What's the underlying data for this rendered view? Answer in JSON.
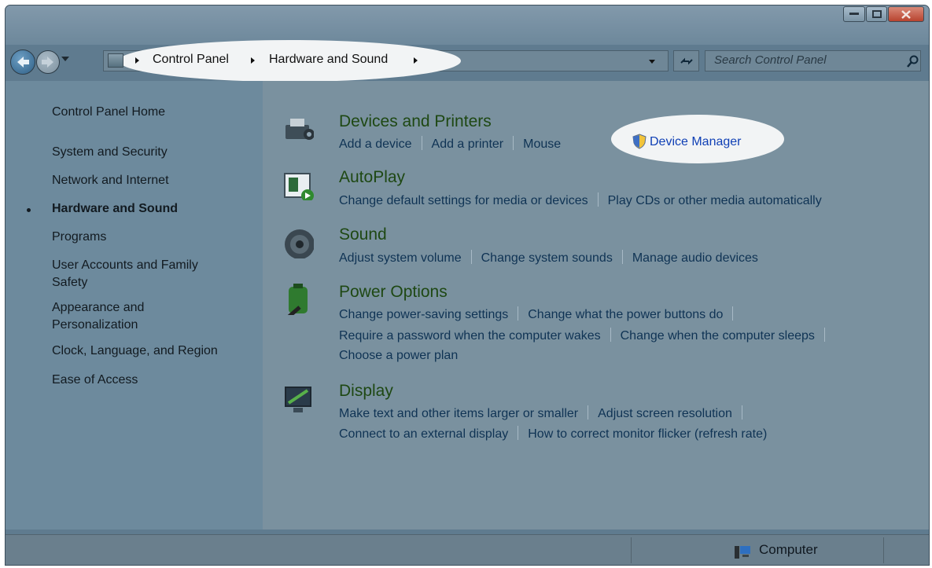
{
  "window": {
    "buttons": [
      "minimize",
      "maximize",
      "close"
    ]
  },
  "nav": {
    "back_icon": "back-arrow-icon",
    "forward_icon": "forward-arrow-icon"
  },
  "address": {
    "breadcrumbs": [
      "Control Panel",
      "Hardware and Sound"
    ],
    "separator_icon": "chevron-right-icon"
  },
  "search": {
    "placeholder": "Search Control Panel",
    "icon": "search-icon"
  },
  "sidebar": {
    "items": [
      {
        "label": "Control Panel Home"
      },
      {
        "label": "System and Security"
      },
      {
        "label": "Network and Internet"
      },
      {
        "label": "Hardware and Sound",
        "active": true
      },
      {
        "label": "Programs"
      },
      {
        "label": "User Accounts and Family Safety"
      },
      {
        "label": "Appearance and Personalization"
      },
      {
        "label": "Clock, Language, and Region"
      },
      {
        "label": "Ease of Access"
      }
    ]
  },
  "categories": [
    {
      "title": "Devices and Printers",
      "icon": "printer-camera-icon",
      "links": [
        "Add a device",
        "Add a printer",
        "Mouse",
        "Device Manager"
      ]
    },
    {
      "title": "AutoPlay",
      "icon": "autoplay-icon",
      "links": [
        "Change default settings for media or devices",
        "Play CDs or other media automatically"
      ]
    },
    {
      "title": "Sound",
      "icon": "speaker-icon",
      "links": [
        "Adjust system volume",
        "Change system sounds",
        "Manage audio devices"
      ]
    },
    {
      "title": "Power Options",
      "icon": "battery-plug-icon",
      "links": [
        "Change power-saving settings",
        "Change what the power buttons do",
        "Require a password when the computer wakes",
        "Change when the computer sleeps",
        "Choose a power plan"
      ]
    },
    {
      "title": "Display",
      "icon": "monitor-icon",
      "links": [
        "Make text and other items larger or smaller",
        "Adjust screen resolution",
        "Connect to an external display",
        "How to correct monitor flicker (refresh rate)"
      ]
    }
  ],
  "highlight": {
    "device_manager_icon": "uac-shield-icon"
  },
  "status": {
    "location": "Computer",
    "icon": "computer-icon"
  },
  "colors": {
    "link": "#0f3354",
    "heading": "#1e4813",
    "highlight_link": "#0f3fb5",
    "overlay": "#7a919f"
  }
}
